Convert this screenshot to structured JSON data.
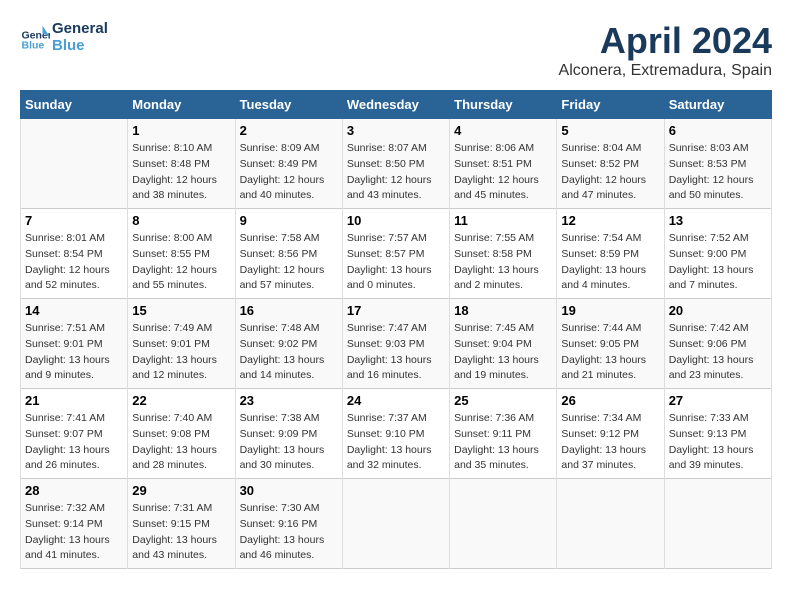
{
  "header": {
    "logo_line1": "General",
    "logo_line2": "Blue",
    "month": "April 2024",
    "location": "Alconera, Extremadura, Spain"
  },
  "days_of_week": [
    "Sunday",
    "Monday",
    "Tuesday",
    "Wednesday",
    "Thursday",
    "Friday",
    "Saturday"
  ],
  "weeks": [
    [
      {
        "day": "",
        "info": ""
      },
      {
        "day": "1",
        "info": "Sunrise: 8:10 AM\nSunset: 8:48 PM\nDaylight: 12 hours\nand 38 minutes."
      },
      {
        "day": "2",
        "info": "Sunrise: 8:09 AM\nSunset: 8:49 PM\nDaylight: 12 hours\nand 40 minutes."
      },
      {
        "day": "3",
        "info": "Sunrise: 8:07 AM\nSunset: 8:50 PM\nDaylight: 12 hours\nand 43 minutes."
      },
      {
        "day": "4",
        "info": "Sunrise: 8:06 AM\nSunset: 8:51 PM\nDaylight: 12 hours\nand 45 minutes."
      },
      {
        "day": "5",
        "info": "Sunrise: 8:04 AM\nSunset: 8:52 PM\nDaylight: 12 hours\nand 47 minutes."
      },
      {
        "day": "6",
        "info": "Sunrise: 8:03 AM\nSunset: 8:53 PM\nDaylight: 12 hours\nand 50 minutes."
      }
    ],
    [
      {
        "day": "7",
        "info": "Sunrise: 8:01 AM\nSunset: 8:54 PM\nDaylight: 12 hours\nand 52 minutes."
      },
      {
        "day": "8",
        "info": "Sunrise: 8:00 AM\nSunset: 8:55 PM\nDaylight: 12 hours\nand 55 minutes."
      },
      {
        "day": "9",
        "info": "Sunrise: 7:58 AM\nSunset: 8:56 PM\nDaylight: 12 hours\nand 57 minutes."
      },
      {
        "day": "10",
        "info": "Sunrise: 7:57 AM\nSunset: 8:57 PM\nDaylight: 13 hours\nand 0 minutes."
      },
      {
        "day": "11",
        "info": "Sunrise: 7:55 AM\nSunset: 8:58 PM\nDaylight: 13 hours\nand 2 minutes."
      },
      {
        "day": "12",
        "info": "Sunrise: 7:54 AM\nSunset: 8:59 PM\nDaylight: 13 hours\nand 4 minutes."
      },
      {
        "day": "13",
        "info": "Sunrise: 7:52 AM\nSunset: 9:00 PM\nDaylight: 13 hours\nand 7 minutes."
      }
    ],
    [
      {
        "day": "14",
        "info": "Sunrise: 7:51 AM\nSunset: 9:01 PM\nDaylight: 13 hours\nand 9 minutes."
      },
      {
        "day": "15",
        "info": "Sunrise: 7:49 AM\nSunset: 9:01 PM\nDaylight: 13 hours\nand 12 minutes."
      },
      {
        "day": "16",
        "info": "Sunrise: 7:48 AM\nSunset: 9:02 PM\nDaylight: 13 hours\nand 14 minutes."
      },
      {
        "day": "17",
        "info": "Sunrise: 7:47 AM\nSunset: 9:03 PM\nDaylight: 13 hours\nand 16 minutes."
      },
      {
        "day": "18",
        "info": "Sunrise: 7:45 AM\nSunset: 9:04 PM\nDaylight: 13 hours\nand 19 minutes."
      },
      {
        "day": "19",
        "info": "Sunrise: 7:44 AM\nSunset: 9:05 PM\nDaylight: 13 hours\nand 21 minutes."
      },
      {
        "day": "20",
        "info": "Sunrise: 7:42 AM\nSunset: 9:06 PM\nDaylight: 13 hours\nand 23 minutes."
      }
    ],
    [
      {
        "day": "21",
        "info": "Sunrise: 7:41 AM\nSunset: 9:07 PM\nDaylight: 13 hours\nand 26 minutes."
      },
      {
        "day": "22",
        "info": "Sunrise: 7:40 AM\nSunset: 9:08 PM\nDaylight: 13 hours\nand 28 minutes."
      },
      {
        "day": "23",
        "info": "Sunrise: 7:38 AM\nSunset: 9:09 PM\nDaylight: 13 hours\nand 30 minutes."
      },
      {
        "day": "24",
        "info": "Sunrise: 7:37 AM\nSunset: 9:10 PM\nDaylight: 13 hours\nand 32 minutes."
      },
      {
        "day": "25",
        "info": "Sunrise: 7:36 AM\nSunset: 9:11 PM\nDaylight: 13 hours\nand 35 minutes."
      },
      {
        "day": "26",
        "info": "Sunrise: 7:34 AM\nSunset: 9:12 PM\nDaylight: 13 hours\nand 37 minutes."
      },
      {
        "day": "27",
        "info": "Sunrise: 7:33 AM\nSunset: 9:13 PM\nDaylight: 13 hours\nand 39 minutes."
      }
    ],
    [
      {
        "day": "28",
        "info": "Sunrise: 7:32 AM\nSunset: 9:14 PM\nDaylight: 13 hours\nand 41 minutes."
      },
      {
        "day": "29",
        "info": "Sunrise: 7:31 AM\nSunset: 9:15 PM\nDaylight: 13 hours\nand 43 minutes."
      },
      {
        "day": "30",
        "info": "Sunrise: 7:30 AM\nSunset: 9:16 PM\nDaylight: 13 hours\nand 46 minutes."
      },
      {
        "day": "",
        "info": ""
      },
      {
        "day": "",
        "info": ""
      },
      {
        "day": "",
        "info": ""
      },
      {
        "day": "",
        "info": ""
      }
    ]
  ]
}
